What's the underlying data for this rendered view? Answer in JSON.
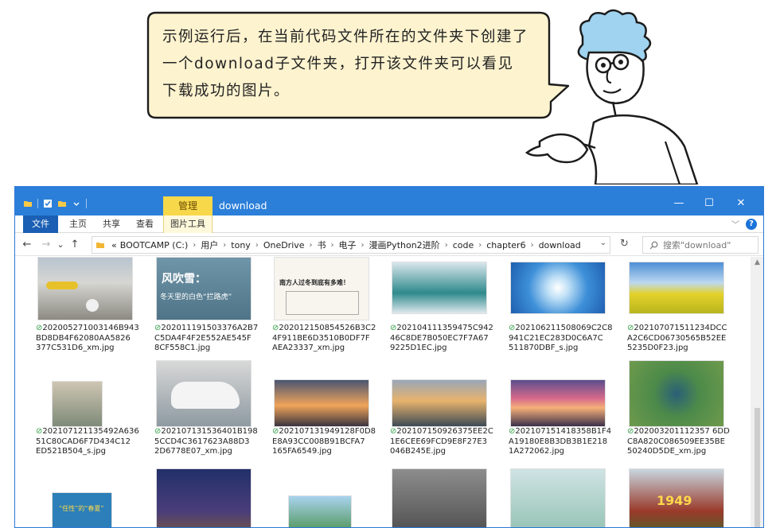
{
  "note": {
    "text_line1": "示例运行后，在当前代码文件所在的文件夹下创建了",
    "text_line2": "一个download子文件夹，打开该文件夹可以看见",
    "text_line3": "下载成功的图片。"
  },
  "window": {
    "title": "download",
    "context_tab": "管理",
    "minimize": "—",
    "maximize": "☐",
    "close": "✕"
  },
  "ribbon": {
    "tabs": [
      "文件",
      "主页",
      "共享",
      "查看",
      "图片工具"
    ],
    "collapse_glyph": "﹀",
    "help": "?"
  },
  "nav": {
    "back": "←",
    "forward": "→",
    "recent": "⌄",
    "up": "↑",
    "overflow": "«",
    "breadcrumbs": [
      "BOOTCAMP (C:)",
      "用户",
      "tony",
      "OneDrive",
      "书",
      "电子",
      "漫画Python2进阶",
      "code",
      "chapter6",
      "download"
    ],
    "dropdown": "⌄",
    "refresh": "↻",
    "search_placeholder": "搜索\"download\""
  },
  "files": [
    {
      "line1": "202005271003146B943",
      "line2": "BD8DB4F62080AA5826",
      "line3": "377C531D6_xm.jpg",
      "thumb": "tent-camp"
    },
    {
      "line1": "202011191503376A2B7",
      "line2": "C5DA4F4F2E552AE545F",
      "line3": "8CF558C1.jpg",
      "thumb": "wind-snow",
      "t1": "风吹雪：",
      "t2": "冬天里的白色“拦路虎”"
    },
    {
      "line1": "202012150854526B3C2",
      "line2": "4F911BE6D3510B0DF7F",
      "line3": "AEA23337_xm.jpg",
      "thumb": "south-winter",
      "t1": "南方人过冬到底有多难！"
    },
    {
      "line1": "202104111359475C942",
      "line2": "46C8DE7B050EC7F7A67",
      "line3": "9225D1EC.jpg",
      "thumb": "tree-fog"
    },
    {
      "line1": "202106211508069C2C8",
      "line2": "941C21EC283D0C6A7C",
      "line3": "511870DBF_s.jpg",
      "thumb": "sun-halo"
    },
    {
      "line1": "202107071511234DCC",
      "line2": "A2C6CD06730565B52EE",
      "line3": "5235D0F23.jpg",
      "thumb": "rapeseed"
    },
    {
      "line1": "202107121135492A636",
      "line2": "51C80CAD6F7D434C12",
      "line3": "ED521B504_s.jpg",
      "thumb": "street-flood"
    },
    {
      "line1": "202107131536401B198",
      "line2": "5CCD4C3617623A88D3",
      "line3": "2D6778E07_xm.jpg",
      "thumb": "car-splash"
    },
    {
      "line1": "202107131949128F0D8",
      "line2": "E8A93CC008B91BCFA7",
      "line3": "165FA6549.jpg",
      "thumb": "sunset-city"
    },
    {
      "line1": "202107150926375EE2C",
      "line2": "1E6CEE69FCD9E8F27E3",
      "line3": "046B245E.jpg",
      "thumb": "dusk-river"
    },
    {
      "line1": "202107151418358B1F4",
      "line2": "A19180E8B3DB3B1E218",
      "line3": "1A272062.jpg",
      "thumb": "pink-sky"
    },
    {
      "line1": "202003201112357 6DD",
      "line2": "C8A820C086509EE35BE",
      "line3": "50240D5DE_xm.jpg",
      "thumb": "satellite"
    },
    {
      "thumb": "blue-poster",
      "t1": "“任性”的“春夏”"
    },
    {
      "thumb": "fireworks"
    },
    {
      "thumb": "sky-leaves"
    },
    {
      "thumb": "walker"
    },
    {
      "thumb": "ducks"
    },
    {
      "thumb": "flower-1949",
      "t1": "1949"
    }
  ],
  "sync_glyph": "⊘"
}
